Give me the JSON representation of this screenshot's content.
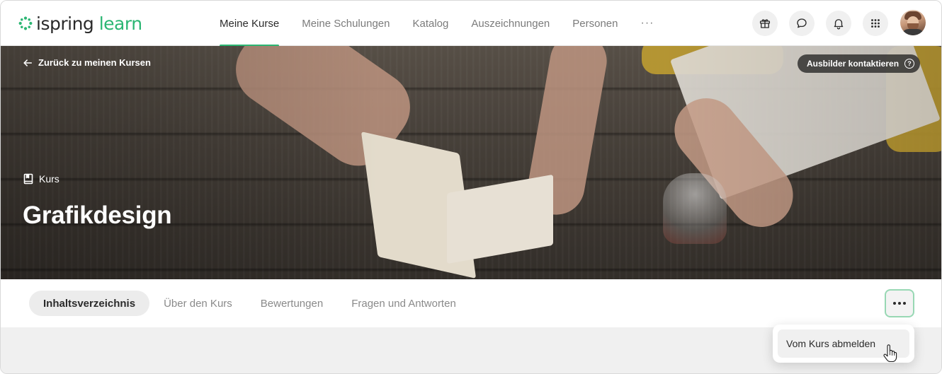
{
  "app": {
    "logo_text_1": "ispring",
    "logo_text_2": "learn",
    "brand_color": "#2bb673"
  },
  "nav": {
    "items": [
      {
        "label": "Meine Kurse",
        "active": true
      },
      {
        "label": "Meine Schulungen",
        "active": false
      },
      {
        "label": "Katalog",
        "active": false
      },
      {
        "label": "Auszeichnungen",
        "active": false
      },
      {
        "label": "Personen",
        "active": false
      }
    ],
    "more": "···"
  },
  "header_icons": [
    "gift-icon",
    "chat-icon",
    "bell-icon",
    "apps-grid-icon",
    "avatar"
  ],
  "hero": {
    "back_label": "Zurück zu meinen Kursen",
    "contact_label": "Ausbilder kontaktieren",
    "contact_help": "?",
    "kind_label": "Kurs",
    "title": "Grafikdesign"
  },
  "tabs": [
    {
      "label": "Inhaltsverzeichnis",
      "active": true
    },
    {
      "label": "Über den Kurs",
      "active": false
    },
    {
      "label": "Bewertungen",
      "active": false
    },
    {
      "label": "Fragen und Antworten",
      "active": false
    }
  ],
  "more_menu": {
    "items": [
      {
        "label": "Vom Kurs abmelden"
      }
    ]
  }
}
